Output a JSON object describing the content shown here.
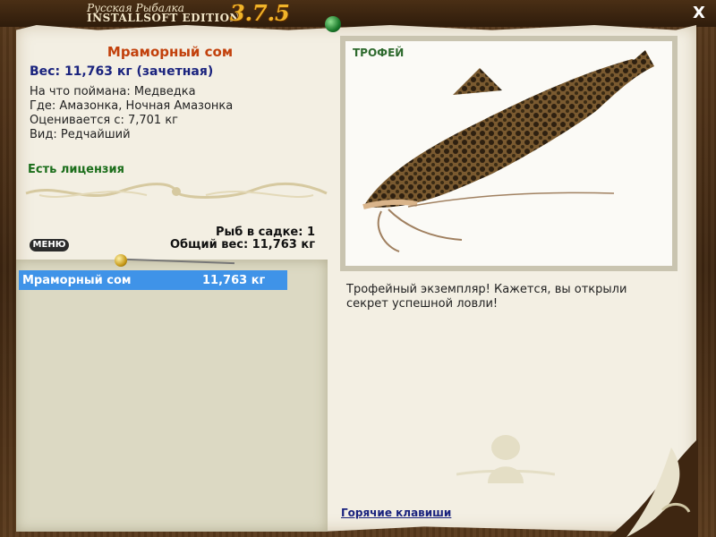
{
  "app": {
    "brand_top": "Русская Рыбалка",
    "brand_bottom": "INSTALLSOFT EDITION",
    "version": "3.7.5",
    "close_label": "X"
  },
  "fish": {
    "name": "Мраморный сом",
    "weight_line": "Вес: 11,763 кг (зачетная)",
    "bait_line": "На что поймана: Медведка",
    "location_line": "Где: Амазонка, Ночная Амазонка",
    "valued_line": "Оценивается с: 7,701 кг",
    "rarity_line": "Вид: Редчайший",
    "license": "Есть лицензия"
  },
  "cage": {
    "count_line": "Рыб в садке: 1",
    "total_line": "Общий вес: 11,763 кг",
    "menu_label": "МЕНЮ",
    "items": [
      {
        "name": "Мраморный сом",
        "weight": "11,763 кг"
      }
    ]
  },
  "trophy": {
    "label": "ТРОФЕЙ",
    "description": "Трофейный экземпляр! Кажется, вы открыли секрет успешной ловли!"
  },
  "footer": {
    "hotkeys": "Горячие клавиши"
  },
  "colors": {
    "fish_name": "#c2410c",
    "weight": "#1a237e",
    "license": "#1b6e1b",
    "selection": "#3f93e8"
  }
}
